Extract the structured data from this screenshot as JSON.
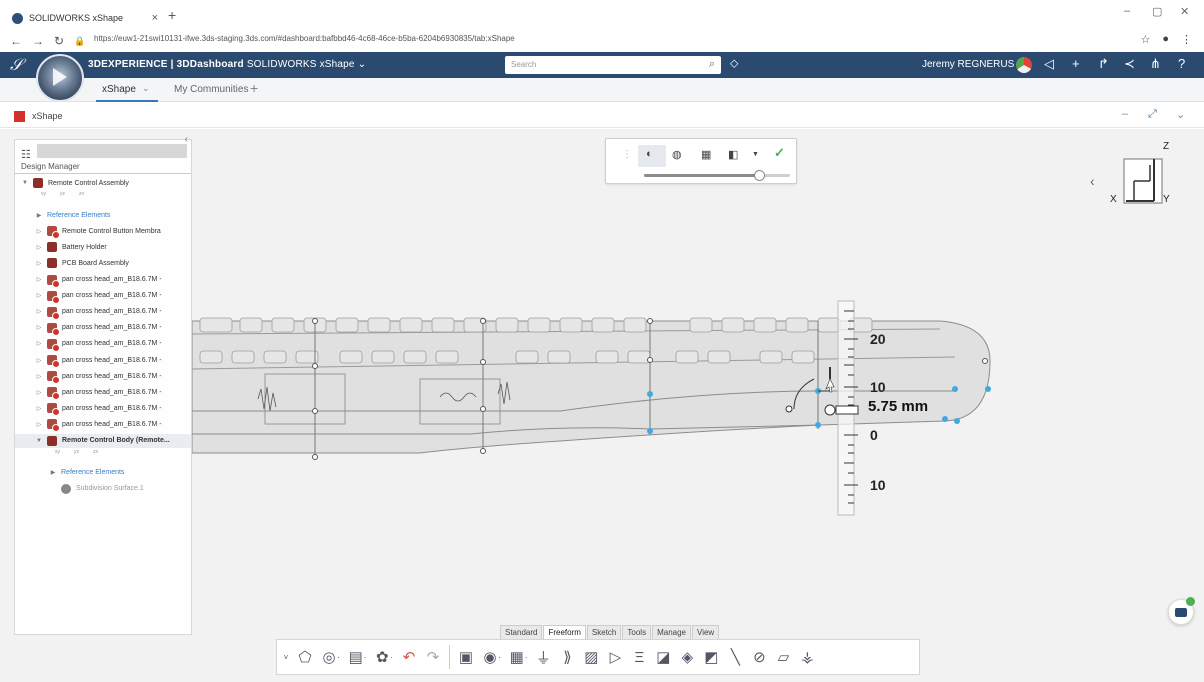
{
  "browser": {
    "tab_title": "SOLIDWORKS xShape",
    "tab_close": "×",
    "new_tab": "+",
    "url": "https://euw1-21swi10131-ifwe.3ds-staging.3ds.com/#dashboard:bafbbd46-4c68-46ce-b5ba-6204b6930835/tab:xShape",
    "win_min": "–",
    "win_max": "▢",
    "win_close": "✕"
  },
  "topbar": {
    "brand": "3DS",
    "app_prefix": "3DEXPERIENCE | 3DDashboard",
    "app_name": "SOLIDWORKS xShape",
    "search_placeholder": "Search",
    "user": "Jeremy REGNERUS"
  },
  "tabs": [
    {
      "label": "xShape"
    },
    {
      "label": "My Communities"
    }
  ],
  "widget": {
    "title": "xShape"
  },
  "design_manager": {
    "title": "Design Manager",
    "plane_labels": [
      "xy",
      "yz",
      "zx"
    ],
    "items": [
      {
        "label": "Remote Control Assembly",
        "twisty": "▼",
        "icon": "asm",
        "indent": 0
      },
      {
        "label": "Reference Elements",
        "twisty": "▶",
        "icon": "none",
        "indent": 1,
        "blue": true
      },
      {
        "label": "Remote Control Button Membra",
        "twisty": "▷",
        "icon": "part",
        "indent": 1
      },
      {
        "label": "Battery Holder",
        "twisty": "▷",
        "icon": "asm",
        "indent": 1
      },
      {
        "label": "PCB Board Assembly",
        "twisty": "▷",
        "icon": "asm",
        "indent": 1
      },
      {
        "label": "pan cross head_am_B18.6.7M -",
        "twisty": "▷",
        "icon": "part",
        "indent": 1
      },
      {
        "label": "pan cross head_am_B18.6.7M -",
        "twisty": "▷",
        "icon": "part",
        "indent": 1
      },
      {
        "label": "pan cross head_am_B18.6.7M -",
        "twisty": "▷",
        "icon": "part",
        "indent": 1
      },
      {
        "label": "pan cross head_am_B18.6.7M -",
        "twisty": "▷",
        "icon": "part",
        "indent": 1
      },
      {
        "label": "pan cross head_am_B18.6.7M -",
        "twisty": "▷",
        "icon": "part",
        "indent": 1
      },
      {
        "label": "pan cross head_am_B18.6.7M -",
        "twisty": "▷",
        "icon": "part",
        "indent": 1
      },
      {
        "label": "pan cross head_am_B18.6.7M -",
        "twisty": "▷",
        "icon": "part",
        "indent": 1
      },
      {
        "label": "pan cross head_am_B18.6.7M -",
        "twisty": "▷",
        "icon": "part",
        "indent": 1
      },
      {
        "label": "pan cross head_am_B18.6.7M -",
        "twisty": "▷",
        "icon": "part",
        "indent": 1
      },
      {
        "label": "pan cross head_am_B18.6.7M -",
        "twisty": "▷",
        "icon": "part",
        "indent": 1
      },
      {
        "label": "Remote Control Body (Remote...",
        "twisty": "▼",
        "icon": "asm",
        "indent": 1,
        "selected": true
      },
      {
        "label": "Reference Elements",
        "twisty": "▶",
        "icon": "none",
        "indent": 2,
        "blue": true
      },
      {
        "label": "Subdivision Surface.1",
        "twisty": "",
        "icon": "subd",
        "indent": 2,
        "grey": true
      }
    ]
  },
  "float_toolbar": {
    "slider_value": 0.79
  },
  "viewcube": {
    "z": "Z",
    "x": "X",
    "y": "Y"
  },
  "ruler": {
    "labels": [
      "20",
      "10",
      "0",
      "10"
    ]
  },
  "dimension": {
    "value": "5.75 mm"
  },
  "command_tabs": [
    "Standard",
    "Freeform",
    "Sketch",
    "Tools",
    "Manage",
    "View"
  ],
  "active_command_tab": "Freeform",
  "colors": {
    "accent": "#2b4a70",
    "handle": "#3fa9e0",
    "ok": "#4caf50",
    "brand_red": "#d6302a"
  }
}
